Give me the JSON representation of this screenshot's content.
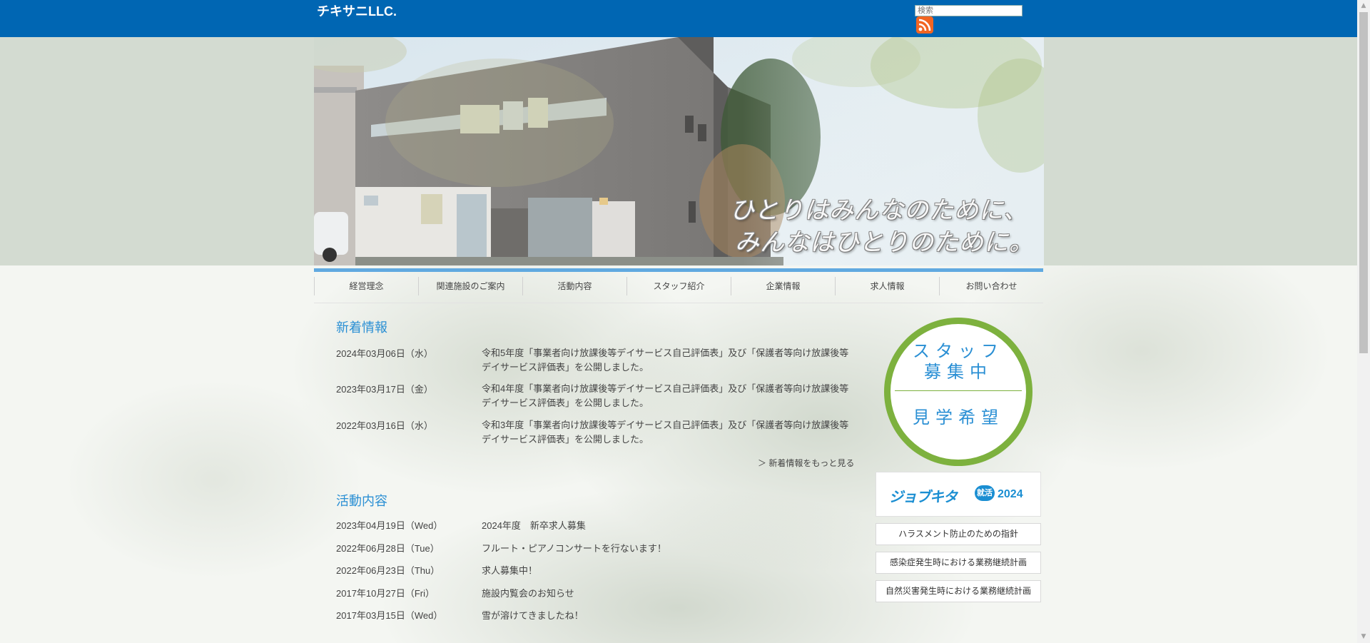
{
  "header": {
    "logo": "チキサニLLC.",
    "search_placeholder": "検索",
    "rss_icon": "rss-icon"
  },
  "hero": {
    "tagline_line1": "ひとりはみんなのために、",
    "tagline_line2": "みんなはひとりのために。"
  },
  "nav": {
    "items": [
      "経営理念",
      "関連施設のご案内",
      "活動内容",
      "スタッフ紹介",
      "企業情報",
      "求人情報",
      "お問い合わせ"
    ]
  },
  "news": {
    "title": "新着情報",
    "items": [
      {
        "date": "2024年03月06日（水）",
        "text": "令和5年度「事業者向け放課後等デイサービス自己評価表」及び「保護者等向け放課後等デイサービス評価表」を公開しました。"
      },
      {
        "date": "2023年03月17日（金）",
        "text": "令和4年度「事業者向け放課後等デイサービス自己評価表」及び「保護者等向け放課後等デイサービス評価表」を公開しました。"
      },
      {
        "date": "2022年03月16日（水）",
        "text": "令和3年度「事業者向け放課後等デイサービス自己評価表」及び「保護者等向け放課後等デイサービス評価表」を公開しました。"
      }
    ],
    "more": "＞ 新着情報をもっと見る"
  },
  "activities": {
    "title": "活動内容",
    "items": [
      {
        "date": "2023年04月19日（Wed）",
        "text": "2024年度　新卒求人募集"
      },
      {
        "date": "2022年06月28日（Tue）",
        "text": "フルート・ピアノコンサートを行ないます！"
      },
      {
        "date": "2022年06月23日（Thu）",
        "text": "求人募集中！"
      },
      {
        "date": "2017年10月27日（Fri）",
        "text": "施設内覧会のお知らせ"
      },
      {
        "date": "2017年03月15日（Wed）",
        "text": "雪が溶けてきましたね！"
      }
    ]
  },
  "sidebar": {
    "badge_top_line1": "スタッフ",
    "badge_top_line2": "募集中",
    "badge_bottom": "見学希望",
    "job_banner": {
      "name": "ジョブキタ",
      "badge": "就活",
      "year": "2024"
    },
    "buttons": [
      "ハラスメント防止のための指針",
      "感染症発生時における業務継続計画",
      "自然災害発生時における業務継続計画"
    ]
  },
  "colors": {
    "header": "#0066b3",
    "accent": "#2a8fd4",
    "green": "#7db13e",
    "band": "#d3dbd1"
  }
}
